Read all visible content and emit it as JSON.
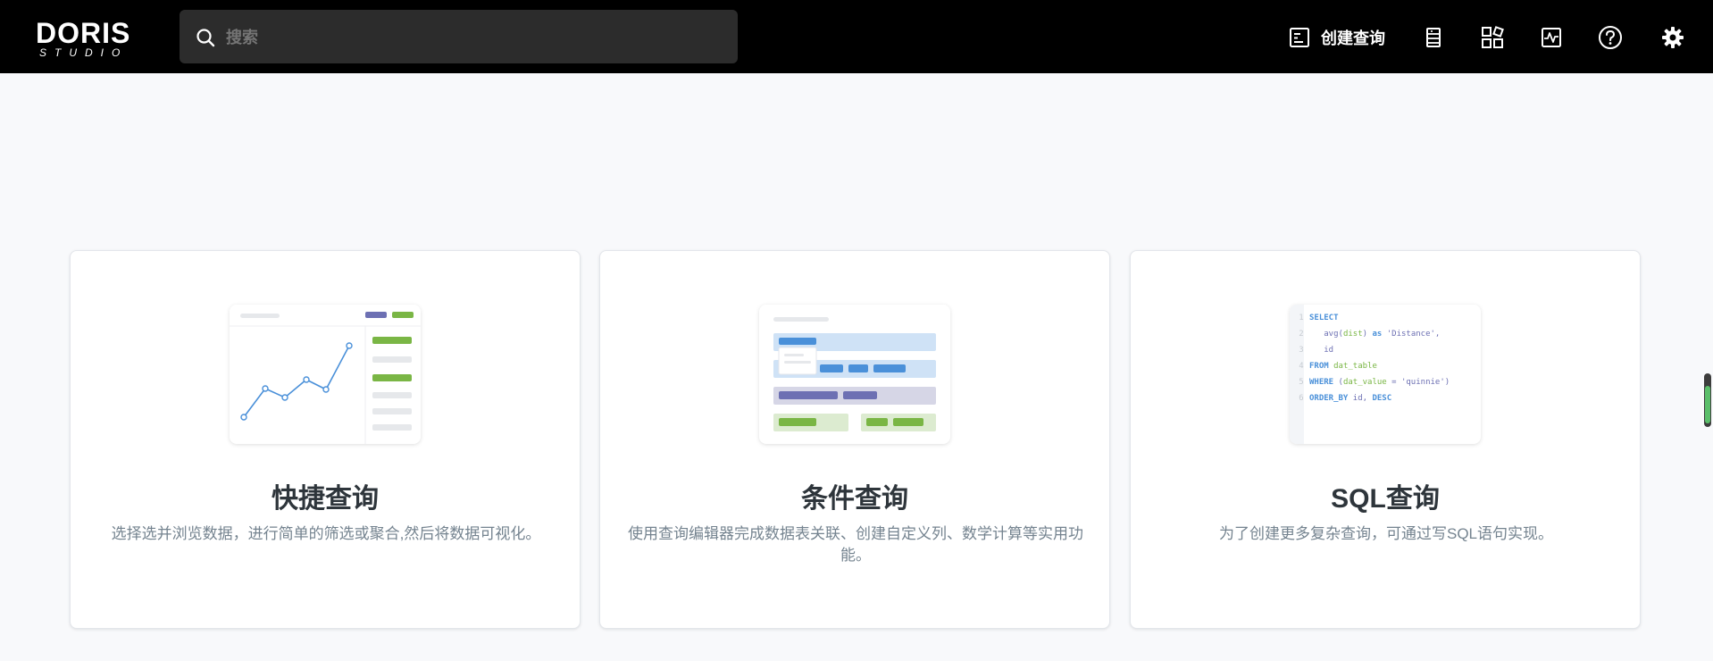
{
  "app": {
    "logo_main": "DORIS",
    "logo_sub": "STUDIO"
  },
  "search": {
    "placeholder": "搜索"
  },
  "nav": {
    "new_query_label": "创建查询",
    "icons": [
      "new-query-icon",
      "data-icon",
      "collections-icon",
      "activity-icon",
      "help-icon",
      "settings-icon"
    ]
  },
  "cards": [
    {
      "title": "快捷查询",
      "description": "选择选并浏览数据，进行简单的筛选或聚合,然后将数据可视化。"
    },
    {
      "title": "条件查询",
      "description": "使用查询编辑器完成数据表关联、创建自定义列、数学计算等实用功能。"
    },
    {
      "title": "SQL查询",
      "description": "为了创建更多复杂查询，可通过写SQL语句实现。"
    }
  ],
  "sql_illustration": {
    "lines": [
      {
        "n": "1",
        "parts": [
          {
            "t": "SELECT",
            "c": "kw"
          }
        ]
      },
      {
        "n": "2",
        "parts": [
          {
            "t": "   avg(",
            "c": "pl"
          },
          {
            "t": "dist",
            "c": "fn"
          },
          {
            "t": ") ",
            "c": "pl"
          },
          {
            "t": "as",
            "c": "kw"
          },
          {
            "t": " 'Distance',",
            "c": "str"
          }
        ]
      },
      {
        "n": "3",
        "parts": [
          {
            "t": "   id",
            "c": "pl"
          }
        ]
      },
      {
        "n": "4",
        "parts": [
          {
            "t": "FROM",
            "c": "kw"
          },
          {
            "t": " dat_table",
            "c": "fn"
          }
        ]
      },
      {
        "n": "5",
        "parts": [
          {
            "t": "WHERE",
            "c": "kw"
          },
          {
            "t": " (",
            "c": "pl"
          },
          {
            "t": "dat_value",
            "c": "fn"
          },
          {
            "t": " = 'quinnie')",
            "c": "str"
          }
        ]
      },
      {
        "n": "6",
        "parts": [
          {
            "t": "ORDER_BY",
            "c": "kw"
          },
          {
            "t": " id, ",
            "c": "pl"
          },
          {
            "t": "DESC",
            "c": "kw"
          }
        ]
      }
    ]
  },
  "colors": {
    "topbar": "#000000",
    "accent_green": "#7ab645",
    "accent_blue": "#4a90d9",
    "accent_purple": "#6d70b3"
  }
}
